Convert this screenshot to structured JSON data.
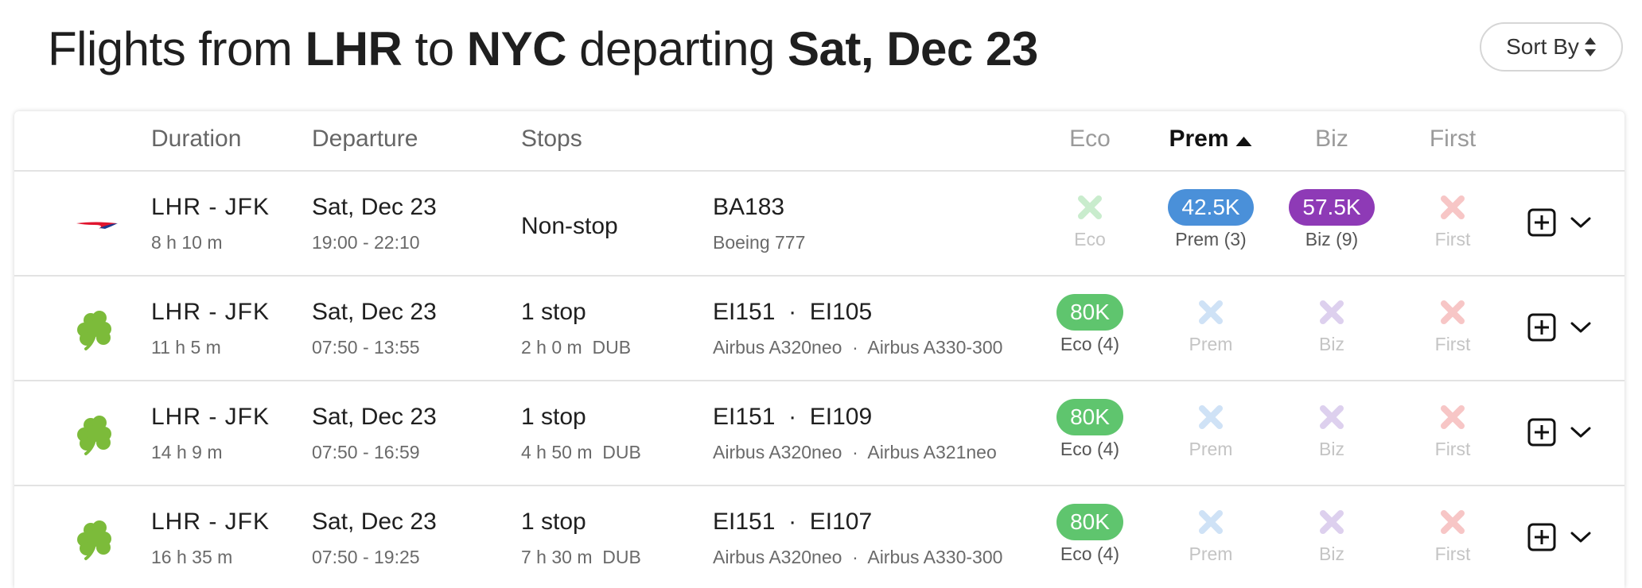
{
  "title": {
    "prefix": "Flights from",
    "origin": "LHR",
    "to_word": "to",
    "destination": "NYC",
    "departing_word": "departing",
    "date": "Sat, Dec 23"
  },
  "sort_button": {
    "label": "Sort By",
    "icon": "sort-updown-icon"
  },
  "columns": {
    "duration": "Duration",
    "departure": "Departure",
    "stops": "Stops",
    "eco": "Eco",
    "prem": "Prem",
    "biz": "Biz",
    "first": "First",
    "active_sort": "prem",
    "sort_direction": "ascending"
  },
  "colors": {
    "eco_pill": "#5fc56e",
    "prem_pill": "#4a90d9",
    "biz_pill": "#8e3ab6",
    "eco_x": "#c9eccd",
    "prem_x": "#cfe2f6",
    "biz_x": "#ddd0ee",
    "first_x": "#f7c6c6"
  },
  "flights": [
    {
      "airline_logo": "british-airways-logo",
      "route": "LHR - JFK",
      "duration": "8 h 10 m",
      "date": "Sat, Dec 23",
      "times": "19:00 - 22:10",
      "stops": "Non-stop",
      "stop_detail": "",
      "flight_numbers": "BA183",
      "aircraft": "Boeing 777",
      "eco": {
        "available": false,
        "value": "",
        "label": "Eco"
      },
      "prem": {
        "available": true,
        "value": "42.5K",
        "label": "Prem (3)"
      },
      "biz": {
        "available": true,
        "value": "57.5K",
        "label": "Biz (9)"
      },
      "first": {
        "available": false,
        "value": "",
        "label": "First"
      }
    },
    {
      "airline_logo": "aer-lingus-shamrock-logo",
      "route": "LHR - JFK",
      "duration": "11 h 5 m",
      "date": "Sat, Dec 23",
      "times": "07:50 - 13:55",
      "stops": "1 stop",
      "stop_detail": "2 h 0 m  DUB",
      "flight_numbers": "EI151  ·  EI105",
      "aircraft": "Airbus A320neo  ·  Airbus A330-300",
      "eco": {
        "available": true,
        "value": "80K",
        "label": "Eco (4)"
      },
      "prem": {
        "available": false,
        "value": "",
        "label": "Prem"
      },
      "biz": {
        "available": false,
        "value": "",
        "label": "Biz"
      },
      "first": {
        "available": false,
        "value": "",
        "label": "First"
      }
    },
    {
      "airline_logo": "aer-lingus-shamrock-logo",
      "route": "LHR - JFK",
      "duration": "14 h 9 m",
      "date": "Sat, Dec 23",
      "times": "07:50 - 16:59",
      "stops": "1 stop",
      "stop_detail": "4 h 50 m  DUB",
      "flight_numbers": "EI151  ·  EI109",
      "aircraft": "Airbus A320neo  ·  Airbus A321neo",
      "eco": {
        "available": true,
        "value": "80K",
        "label": "Eco (4)"
      },
      "prem": {
        "available": false,
        "value": "",
        "label": "Prem"
      },
      "biz": {
        "available": false,
        "value": "",
        "label": "Biz"
      },
      "first": {
        "available": false,
        "value": "",
        "label": "First"
      }
    },
    {
      "airline_logo": "aer-lingus-shamrock-logo",
      "route": "LHR - JFK",
      "duration": "16 h 35 m",
      "date": "Sat, Dec 23",
      "times": "07:50 - 19:25",
      "stops": "1 stop",
      "stop_detail": "7 h 30 m  DUB",
      "flight_numbers": "EI151  ·  EI107",
      "aircraft": "Airbus A320neo  ·  Airbus A330-300",
      "eco": {
        "available": true,
        "value": "80K",
        "label": "Eco (4)"
      },
      "prem": {
        "available": false,
        "value": "",
        "label": "Prem"
      },
      "biz": {
        "available": false,
        "value": "",
        "label": "Biz"
      },
      "first": {
        "available": false,
        "value": "",
        "label": "First"
      }
    }
  ]
}
